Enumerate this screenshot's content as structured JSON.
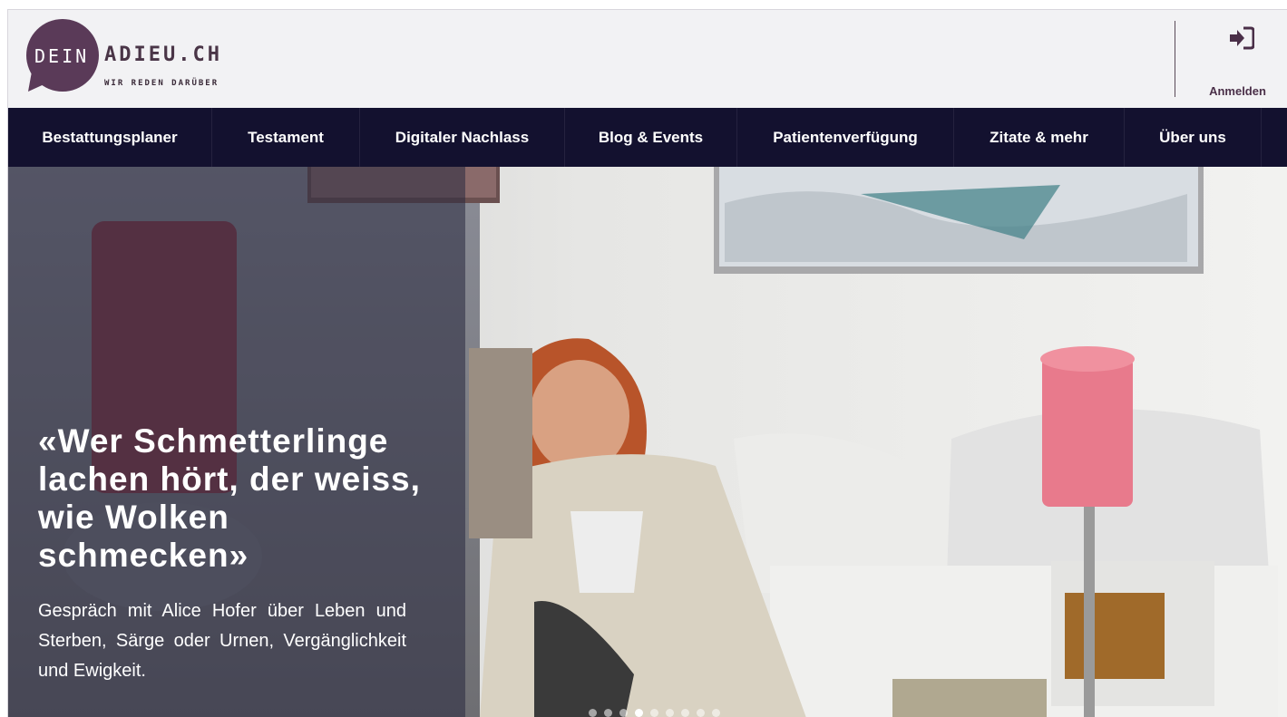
{
  "logo": {
    "part1": "DEIN",
    "part2": "ADIEU.CH",
    "tagline": "WIR REDEN DARÜBER",
    "color": "#5a3a58"
  },
  "header": {
    "login_label": "Anmelden",
    "login_icon": "sign-in-icon"
  },
  "nav": {
    "items": [
      {
        "label": "Bestattungsplaner"
      },
      {
        "label": "Testament"
      },
      {
        "label": "Digitaler Nachlass"
      },
      {
        "label": "Blog & Events"
      },
      {
        "label": "Patientenverfügung"
      },
      {
        "label": "Zitate & mehr"
      },
      {
        "label": "Über uns"
      }
    ],
    "background": "#13112f"
  },
  "hero": {
    "title": "«Wer Schmetterlinge lachen hört, der weiss, wie Wolken schmecken»",
    "subtitle": "Gespräch mit Alice Hofer über Leben und Sterben, Särge oder Urnen, Vergänglichkeit und Ewigkeit.",
    "slider": {
      "count": 9,
      "active_index": 3
    }
  }
}
